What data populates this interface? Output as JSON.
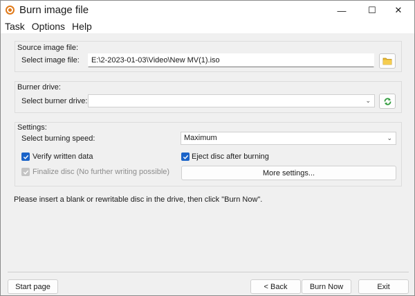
{
  "window": {
    "title": "Burn image file",
    "min_glyph": "—",
    "max_glyph": "☐",
    "close_glyph": "✕"
  },
  "menu": [
    "Task",
    "Options",
    "Help"
  ],
  "source": {
    "group_label": "Source image file:",
    "field_label": "Select image file:",
    "path_value": "E:\\2-2023-01-03\\Video\\New MV(1).iso",
    "browse_icon": "folder-icon"
  },
  "burner": {
    "group_label": "Burner drive:",
    "field_label": "Select burner drive:",
    "selected_value": "",
    "refresh_icon": "refresh-icon"
  },
  "settings": {
    "group_label": "Settings:",
    "speed_label": "Select burning speed:",
    "speed_value": "Maximum",
    "verify_label": "Verify written data",
    "verify_checked": true,
    "eject_label": "Eject disc after burning",
    "eject_checked": true,
    "finalize_label": "Finalize disc (No further writing possible)",
    "finalize_checked": true,
    "finalize_disabled": true,
    "more_settings_label": "More settings..."
  },
  "status_message": "Please insert a blank or rewritable disc in the drive, then click \"Burn Now\".",
  "footer": {
    "start_page_label": "Start page",
    "back_label": "< Back",
    "burn_now_label": "Burn Now",
    "exit_label": "Exit"
  },
  "colors": {
    "accent": "#1a63c8",
    "folder": "#e8b830",
    "refresh": "#2e9a3a",
    "app_icon": "#e07a1a"
  }
}
